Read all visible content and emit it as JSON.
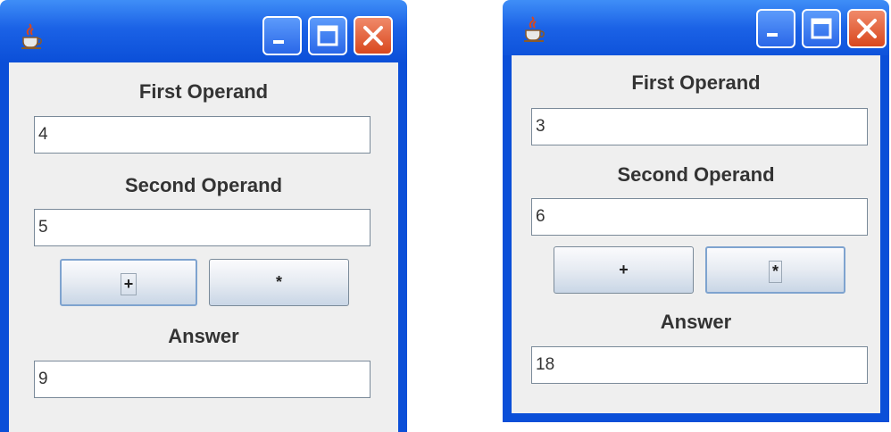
{
  "windows": [
    {
      "first_operand": {
        "label": "First Operand",
        "value": "4"
      },
      "second_operand": {
        "label": "Second Operand",
        "value": "5"
      },
      "buttons": {
        "plus": "+",
        "times": "*"
      },
      "answer": {
        "label": "Answer",
        "value": "9"
      }
    },
    {
      "first_operand": {
        "label": "First Operand",
        "value": "3"
      },
      "second_operand": {
        "label": "Second Operand",
        "value": "6"
      },
      "buttons": {
        "plus": "+",
        "times": "*"
      },
      "answer": {
        "label": "Answer",
        "value": "18"
      }
    }
  ],
  "titlebar": {
    "icon": "java-cup-icon",
    "controls": [
      "minimize-icon",
      "maximize-icon",
      "close-icon"
    ]
  },
  "colors": {
    "titlebar": "#0b4fd8",
    "client": "#efefef",
    "close": "#d9481e"
  }
}
